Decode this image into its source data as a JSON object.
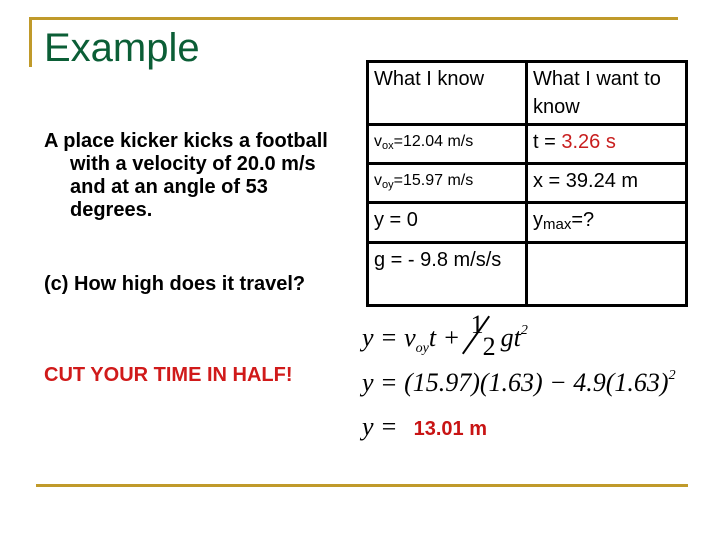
{
  "slide": {
    "title": "Example",
    "problem_text": "A place kicker kicks a football with a velocity of 20.0 m/s and at an angle of 53 degrees.",
    "question_text": "(c) How high does it travel?",
    "hint_text": "CUT YOUR TIME IN HALF!",
    "colors": {
      "title": "#0b5e36",
      "rule": "#c09a2a",
      "highlight": "#c81e1e"
    }
  },
  "table": {
    "headers": [
      "What I know",
      "What I want to know"
    ],
    "rows": [
      {
        "known": {
          "var": "v",
          "sub": "ox",
          "value": "=12.04 m/s"
        },
        "want_prefix": "t = ",
        "want_value": "3.26 s"
      },
      {
        "known": {
          "var": "v",
          "sub": "oy",
          "value": "=15.97 m/s"
        },
        "want": "x = 39.24 m"
      },
      {
        "known_text": "y = 0",
        "want": {
          "var": "y",
          "sub": "max",
          "value": "=?"
        }
      },
      {
        "known_text": "g = - 9.8 m/s/s",
        "want_text": ""
      }
    ]
  },
  "equations": {
    "eq1": {
      "lhs": "y = v",
      "sub": "oy",
      "mid": "t + ",
      "num": "1",
      "den": "2",
      "rhs": "gt",
      "exp": "2"
    },
    "eq2": {
      "text": "y = (15.97)(1.63) − 4.9(1.63)",
      "exp": "2"
    },
    "eq3": {
      "lhs": "y =",
      "answer": "13.01 m"
    }
  }
}
